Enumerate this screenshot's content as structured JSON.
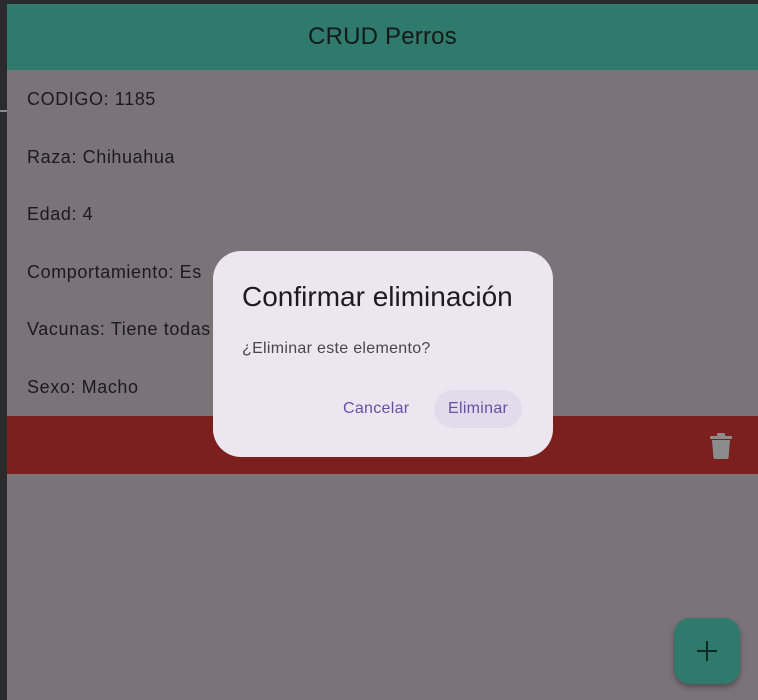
{
  "appbar": {
    "title": "CRUD Perros"
  },
  "record": {
    "fields": [
      "CODIGO: 1185",
      "Raza: Chihuahua",
      "Edad: 4",
      "Comportamiento: Es",
      "Vacunas: Tiene todas",
      "Sexo: Macho"
    ]
  },
  "delete_bar": {
    "icon": "trash-icon",
    "color": "#7b201c"
  },
  "fab": {
    "icon": "plus-icon",
    "color": "#2f7a6c"
  },
  "dialog": {
    "title": "Confirmar eliminación",
    "message": "¿Eliminar este elemento?",
    "cancel_label": "Cancelar",
    "delete_label": "Eliminar"
  }
}
